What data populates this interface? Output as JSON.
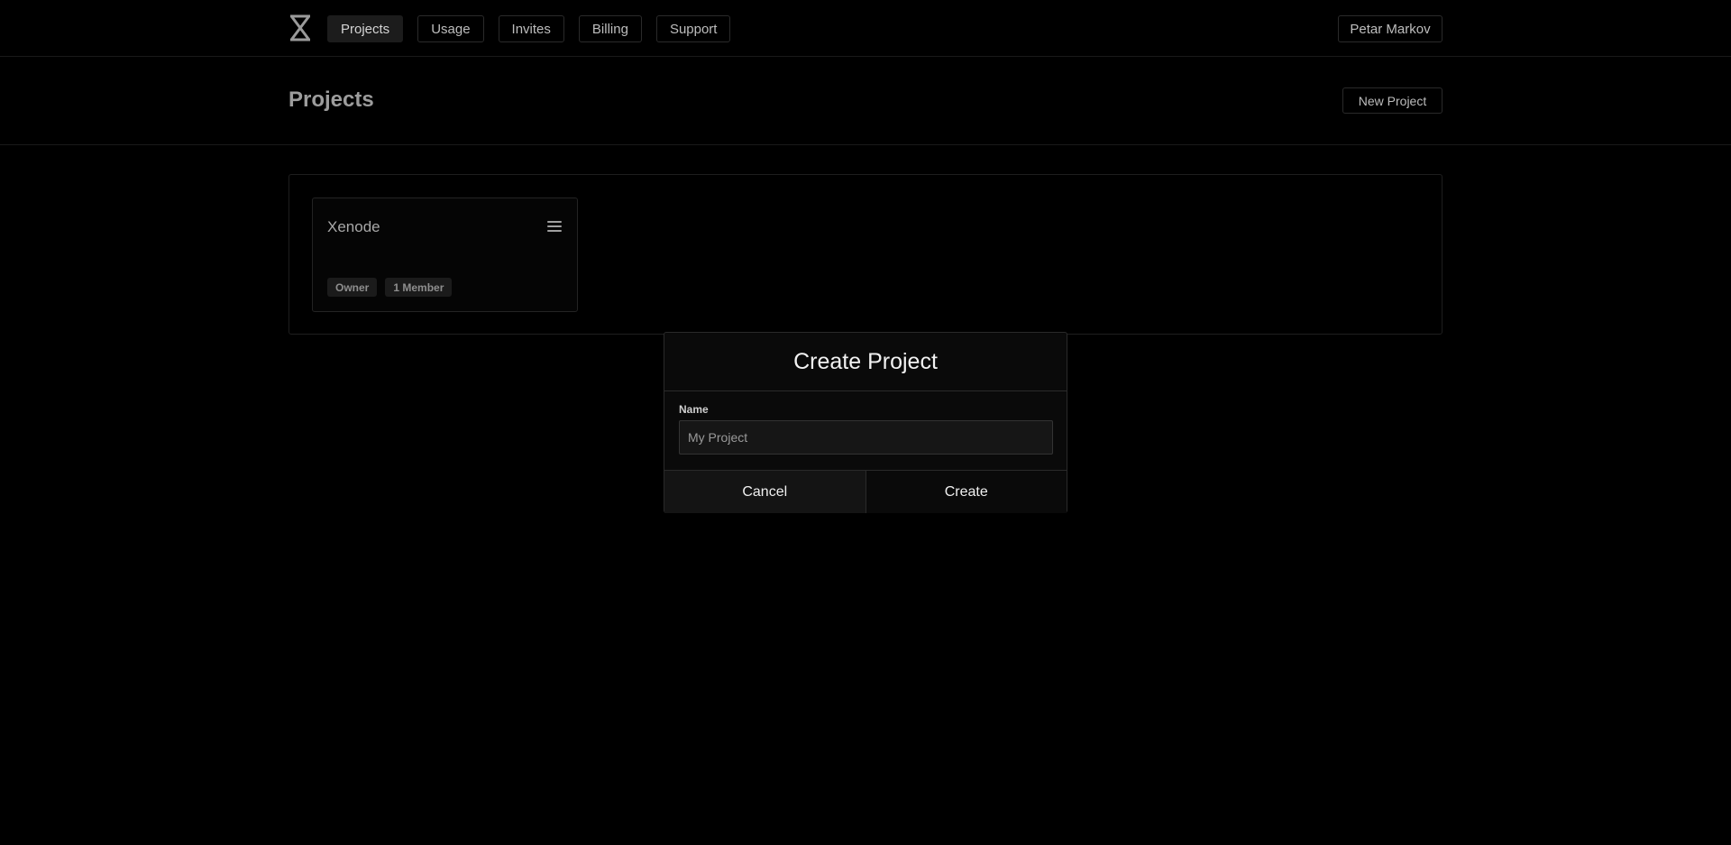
{
  "nav": {
    "items": [
      {
        "label": "Projects",
        "active": true
      },
      {
        "label": "Usage"
      },
      {
        "label": "Invites"
      },
      {
        "label": "Billing"
      },
      {
        "label": "Support"
      }
    ],
    "user": "Petar Markov"
  },
  "header": {
    "title": "Projects",
    "new_project_label": "New Project"
  },
  "projects": [
    {
      "name": "Xenode",
      "badges": [
        "Owner",
        "1 Member"
      ]
    }
  ],
  "modal": {
    "title": "Create Project",
    "field_label": "Name",
    "field_placeholder": "My Project",
    "cancel_label": "Cancel",
    "create_label": "Create"
  },
  "colors": {
    "background": "#000000",
    "border": "#2a2a2a",
    "active_tab": "#1c1c1c"
  }
}
